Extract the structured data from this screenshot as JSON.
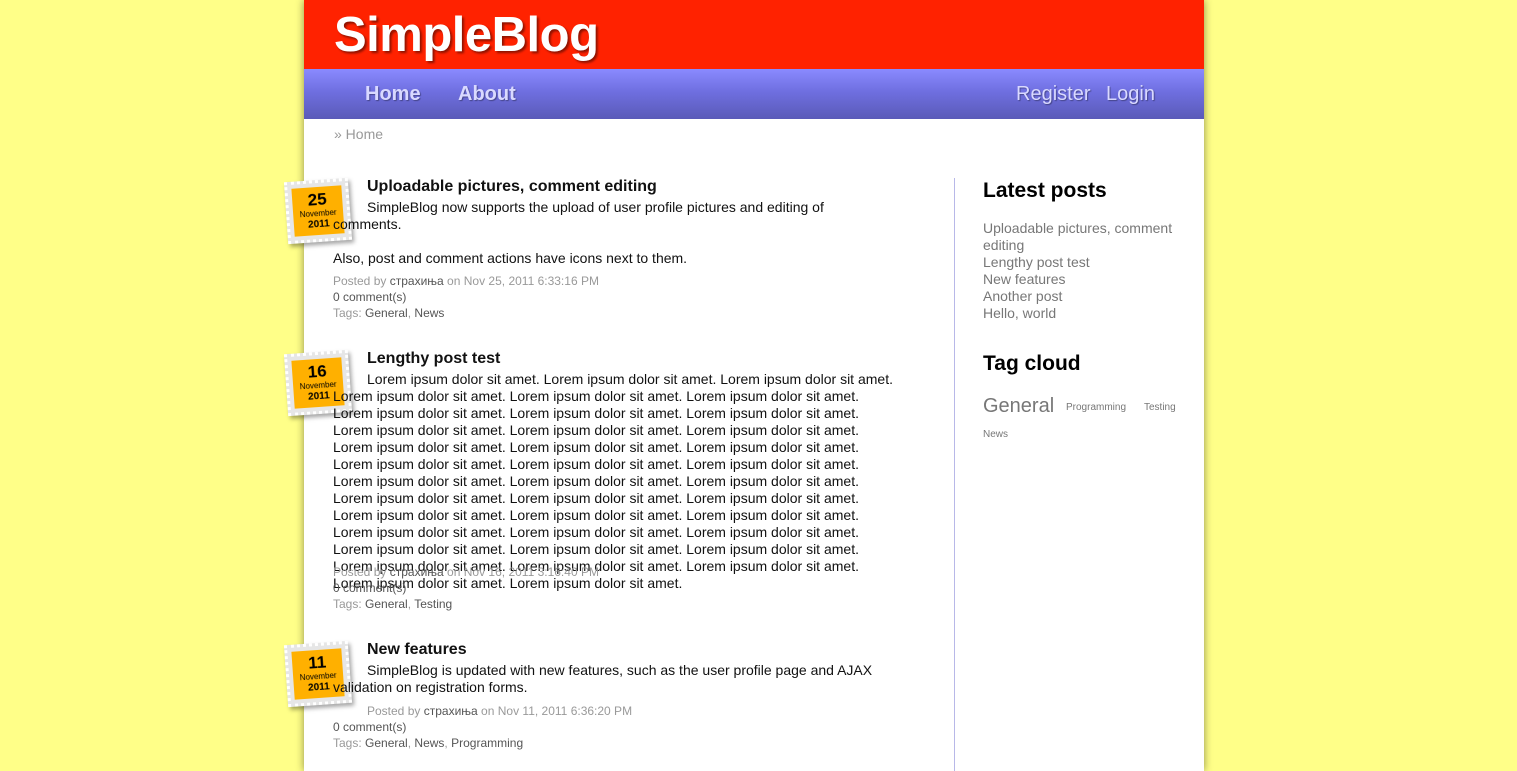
{
  "site": {
    "title": "SimpleBlog"
  },
  "nav": {
    "home": "Home",
    "about": "About",
    "register": "Register",
    "login": "Login"
  },
  "breadcrumb": "» Home",
  "posts": [
    {
      "day": "25",
      "month": "November",
      "year": "2011",
      "title": "Uploadable pictures, comment editing",
      "body": "SimpleBlog now supports the upload of user profile pictures and editing of comments.",
      "body2": "Also, post and comment actions have icons next to them.",
      "posted_by_label": "Posted by",
      "author": "страхиња",
      "on_label": "on",
      "date": "Nov 25, 2011 6:33:16 PM",
      "comments": "0 comment(s)",
      "tags_label": "Tags:",
      "tags": [
        "General",
        "News"
      ]
    },
    {
      "day": "16",
      "month": "November",
      "year": "2011",
      "title": "Lengthy post test",
      "body": "Lorem ipsum dolor sit amet. Lorem ipsum dolor sit amet. Lorem ipsum dolor sit amet. Lorem ipsum dolor sit amet. Lorem ipsum dolor sit amet. Lorem ipsum dolor sit amet. Lorem ipsum dolor sit amet. Lorem ipsum dolor sit amet. Lorem ipsum dolor sit amet. Lorem ipsum dolor sit amet. Lorem ipsum dolor sit amet. Lorem ipsum dolor sit amet. Lorem ipsum dolor sit amet. Lorem ipsum dolor sit amet. Lorem ipsum dolor sit amet. Lorem ipsum dolor sit amet. Lorem ipsum dolor sit amet. Lorem ipsum dolor sit amet. Lorem ipsum dolor sit amet. Lorem ipsum dolor sit amet. Lorem ipsum dolor sit amet. Lorem ipsum dolor sit amet. Lorem ipsum dolor sit amet. Lorem ipsum dolor sit amet. Lorem ipsum dolor sit amet. Lorem ipsum dolor sit amet. Lorem ipsum dolor sit amet. Lorem ipsum dolor sit amet. Lorem ipsum dolor sit amet. Lorem ipsum dolor sit amet. Lorem ipsum dolor sit amet. Lorem ipsum dolor sit amet. Lorem ipsum dolor sit amet. Lorem ipsum dolor sit amet. Lorem ipsum dolor sit amet. Lorem ipsum dolor sit amet. Lorem ipsum dolor sit amet. Lorem ipsum dolor sit amet.",
      "posted_by_label": "Posted by",
      "author": "страхиња",
      "on_label": "on",
      "date": "Nov 16, 2011 3:16:40 PM",
      "comments": "0 comment(s)",
      "tags_label": "Tags:",
      "tags": [
        "General",
        "Testing"
      ]
    },
    {
      "day": "11",
      "month": "November",
      "year": "2011",
      "title": "New features",
      "body": "SimpleBlog is updated with new features, such as the user profile page and AJAX validation on registration forms.",
      "posted_by_label": "Posted by",
      "author": "страхиња",
      "on_label": "on",
      "date": "Nov 11, 2011 6:36:20 PM",
      "comments": "0 comment(s)",
      "tags_label": "Tags:",
      "tags": [
        "General",
        "News",
        "Programming"
      ]
    }
  ],
  "sidebar": {
    "latest_title": "Latest posts",
    "latest": [
      "Uploadable pictures, comment editing",
      "Lengthy post test",
      "New features",
      "Another post",
      "Hello, world"
    ],
    "tagcloud_title": "Tag cloud",
    "tags": [
      "General",
      "Programming",
      "Testing",
      "News"
    ]
  },
  "colors": {
    "background": "#ffff88",
    "header": "#ff2200",
    "nav": "#6f6fe0",
    "stamp": "#ffb000"
  }
}
